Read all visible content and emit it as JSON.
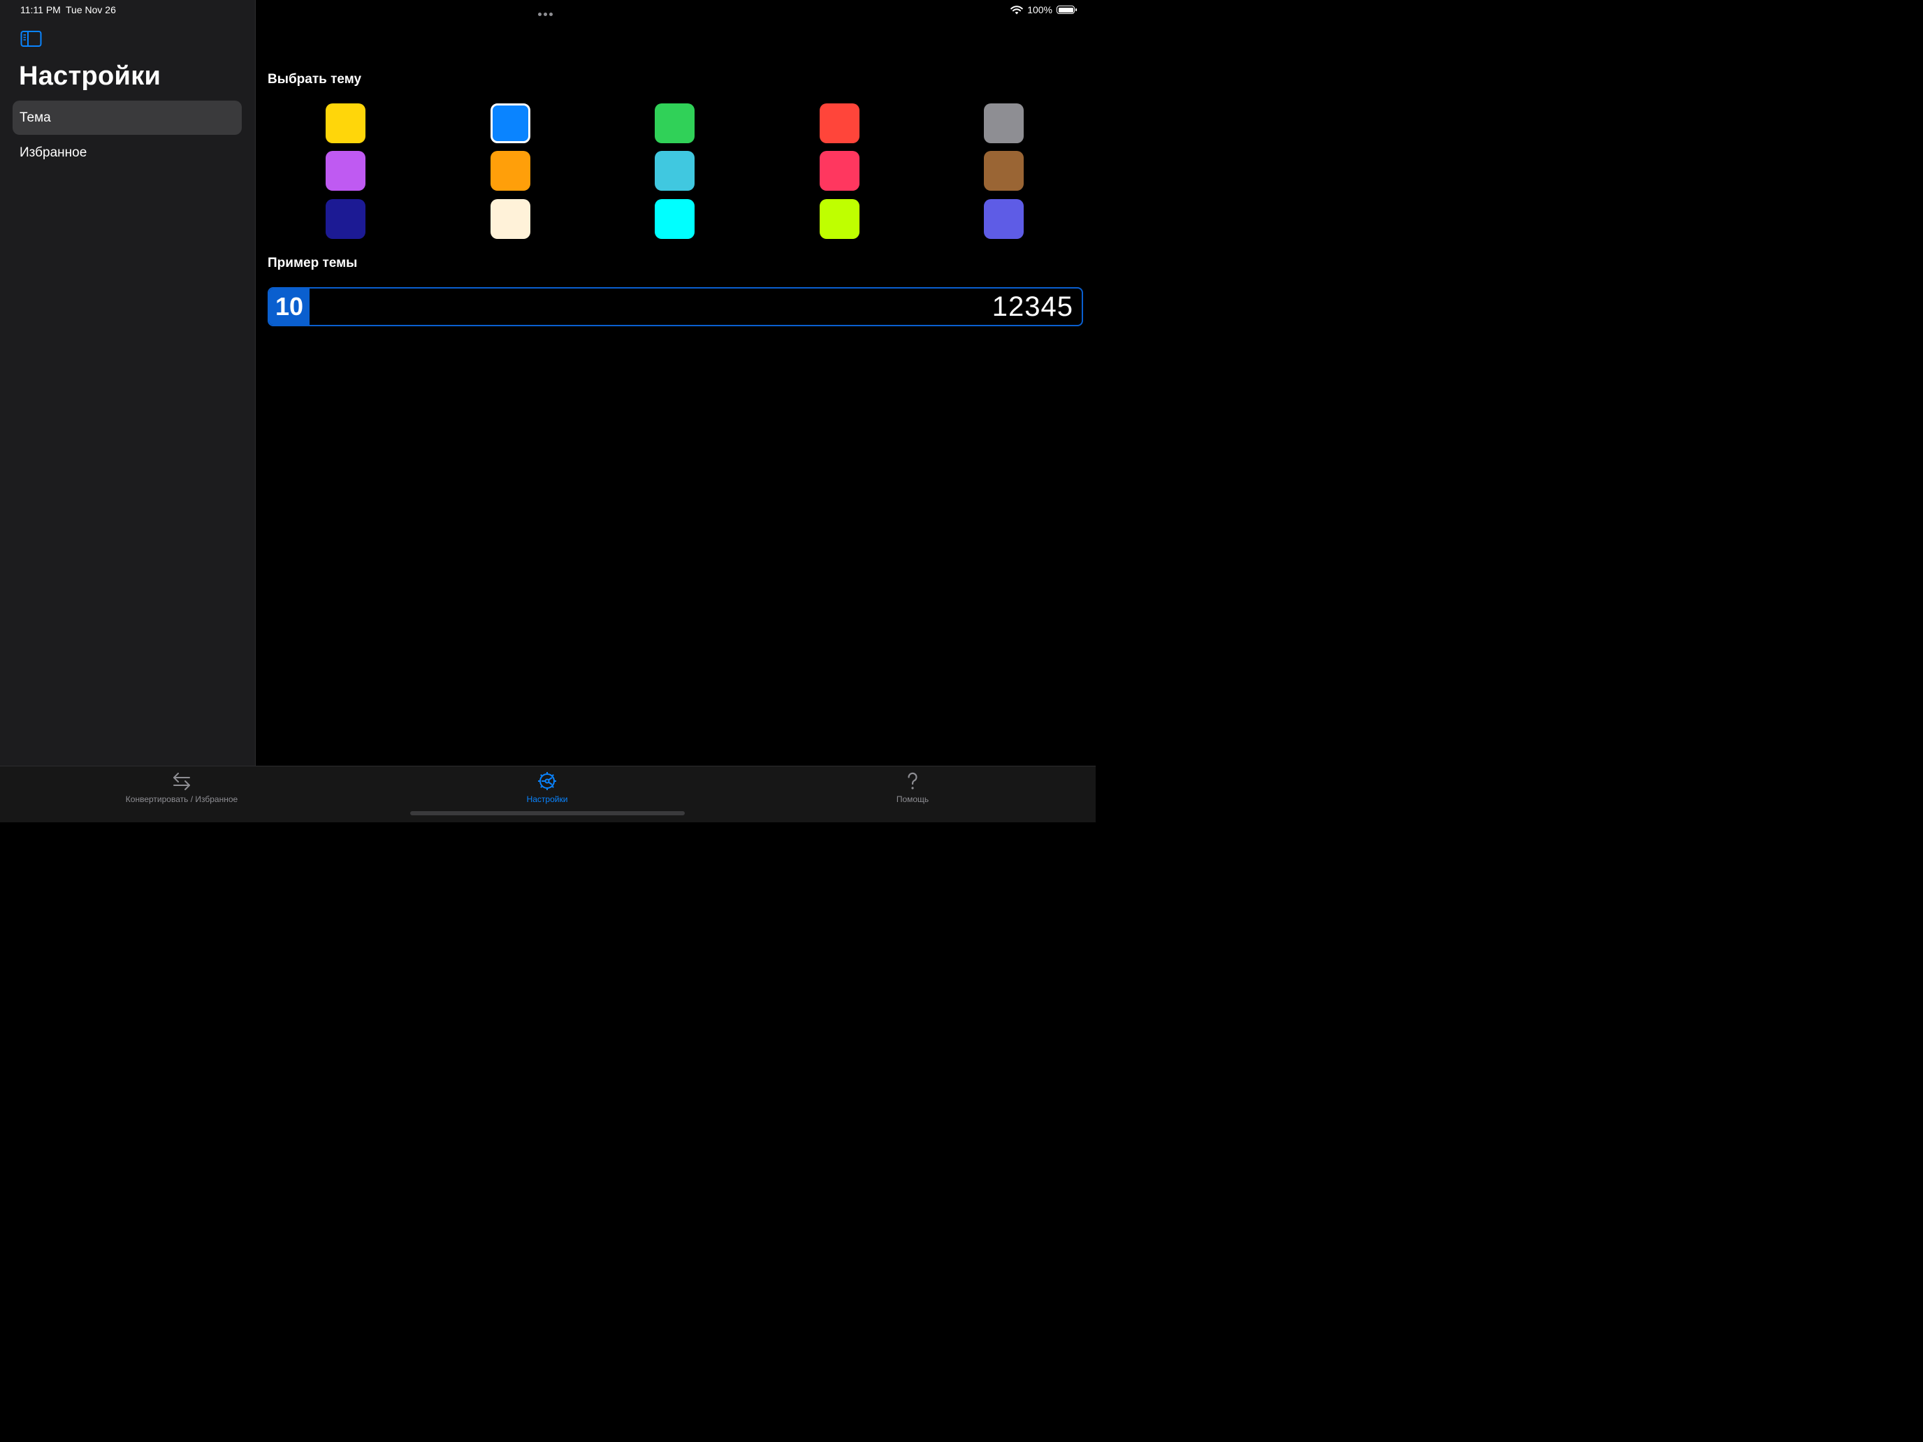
{
  "status": {
    "time": "11:11 PM",
    "date": "Tue Nov 26",
    "battery": "100%"
  },
  "sidebar": {
    "title": "Настройки",
    "items": [
      {
        "label": "Тема",
        "selected": true
      },
      {
        "label": "Избранное",
        "selected": false
      }
    ]
  },
  "main": {
    "theme_section_title": "Выбрать тему",
    "swatches": [
      "#FFD60A",
      "#0A84FF",
      "#30D158",
      "#FF453A",
      "#8E8E93",
      "#BF5AF2",
      "#FF9F0A",
      "#40C8E0",
      "#FF375F",
      "#9A6534",
      "#1C1A94",
      "#FFF2D9",
      "#00FFFF",
      "#BFFF00",
      "#5E5CE6"
    ],
    "selected_swatch": "#0A84FF",
    "sample_section_title": "Пример темы",
    "sample": {
      "badge": "10",
      "value": "12345"
    }
  },
  "tabbar": {
    "tabs": [
      {
        "label": "Конвертировать / Избранное",
        "icon": "arrows-swap-icon",
        "active": false
      },
      {
        "label": "Настройки",
        "icon": "settings-gear-icon",
        "active": true
      },
      {
        "label": "Помощь",
        "icon": "question-mark-icon",
        "active": false
      }
    ]
  },
  "colors": {
    "accent": "#0A84FF",
    "sidebar_bg": "#1C1C1E",
    "selected_row": "#3A3A3C"
  }
}
